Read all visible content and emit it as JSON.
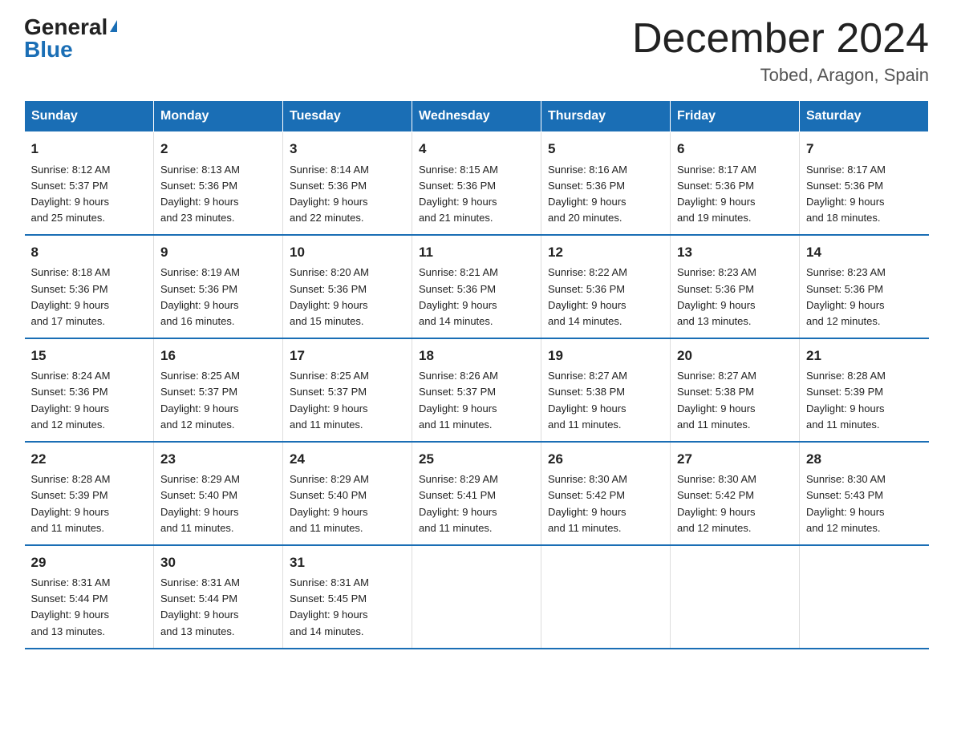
{
  "logo": {
    "general": "General",
    "blue": "Blue",
    "triangle": "▶"
  },
  "title": "December 2024",
  "subtitle": "Tobed, Aragon, Spain",
  "days_header": [
    "Sunday",
    "Monday",
    "Tuesday",
    "Wednesday",
    "Thursday",
    "Friday",
    "Saturday"
  ],
  "weeks": [
    [
      {
        "day": "1",
        "sunrise": "8:12 AM",
        "sunset": "5:37 PM",
        "daylight": "9 hours and 25 minutes."
      },
      {
        "day": "2",
        "sunrise": "8:13 AM",
        "sunset": "5:36 PM",
        "daylight": "9 hours and 23 minutes."
      },
      {
        "day": "3",
        "sunrise": "8:14 AM",
        "sunset": "5:36 PM",
        "daylight": "9 hours and 22 minutes."
      },
      {
        "day": "4",
        "sunrise": "8:15 AM",
        "sunset": "5:36 PM",
        "daylight": "9 hours and 21 minutes."
      },
      {
        "day": "5",
        "sunrise": "8:16 AM",
        "sunset": "5:36 PM",
        "daylight": "9 hours and 20 minutes."
      },
      {
        "day": "6",
        "sunrise": "8:17 AM",
        "sunset": "5:36 PM",
        "daylight": "9 hours and 19 minutes."
      },
      {
        "day": "7",
        "sunrise": "8:17 AM",
        "sunset": "5:36 PM",
        "daylight": "9 hours and 18 minutes."
      }
    ],
    [
      {
        "day": "8",
        "sunrise": "8:18 AM",
        "sunset": "5:36 PM",
        "daylight": "9 hours and 17 minutes."
      },
      {
        "day": "9",
        "sunrise": "8:19 AM",
        "sunset": "5:36 PM",
        "daylight": "9 hours and 16 minutes."
      },
      {
        "day": "10",
        "sunrise": "8:20 AM",
        "sunset": "5:36 PM",
        "daylight": "9 hours and 15 minutes."
      },
      {
        "day": "11",
        "sunrise": "8:21 AM",
        "sunset": "5:36 PM",
        "daylight": "9 hours and 14 minutes."
      },
      {
        "day": "12",
        "sunrise": "8:22 AM",
        "sunset": "5:36 PM",
        "daylight": "9 hours and 14 minutes."
      },
      {
        "day": "13",
        "sunrise": "8:23 AM",
        "sunset": "5:36 PM",
        "daylight": "9 hours and 13 minutes."
      },
      {
        "day": "14",
        "sunrise": "8:23 AM",
        "sunset": "5:36 PM",
        "daylight": "9 hours and 12 minutes."
      }
    ],
    [
      {
        "day": "15",
        "sunrise": "8:24 AM",
        "sunset": "5:36 PM",
        "daylight": "9 hours and 12 minutes."
      },
      {
        "day": "16",
        "sunrise": "8:25 AM",
        "sunset": "5:37 PM",
        "daylight": "9 hours and 12 minutes."
      },
      {
        "day": "17",
        "sunrise": "8:25 AM",
        "sunset": "5:37 PM",
        "daylight": "9 hours and 11 minutes."
      },
      {
        "day": "18",
        "sunrise": "8:26 AM",
        "sunset": "5:37 PM",
        "daylight": "9 hours and 11 minutes."
      },
      {
        "day": "19",
        "sunrise": "8:27 AM",
        "sunset": "5:38 PM",
        "daylight": "9 hours and 11 minutes."
      },
      {
        "day": "20",
        "sunrise": "8:27 AM",
        "sunset": "5:38 PM",
        "daylight": "9 hours and 11 minutes."
      },
      {
        "day": "21",
        "sunrise": "8:28 AM",
        "sunset": "5:39 PM",
        "daylight": "9 hours and 11 minutes."
      }
    ],
    [
      {
        "day": "22",
        "sunrise": "8:28 AM",
        "sunset": "5:39 PM",
        "daylight": "9 hours and 11 minutes."
      },
      {
        "day": "23",
        "sunrise": "8:29 AM",
        "sunset": "5:40 PM",
        "daylight": "9 hours and 11 minutes."
      },
      {
        "day": "24",
        "sunrise": "8:29 AM",
        "sunset": "5:40 PM",
        "daylight": "9 hours and 11 minutes."
      },
      {
        "day": "25",
        "sunrise": "8:29 AM",
        "sunset": "5:41 PM",
        "daylight": "9 hours and 11 minutes."
      },
      {
        "day": "26",
        "sunrise": "8:30 AM",
        "sunset": "5:42 PM",
        "daylight": "9 hours and 11 minutes."
      },
      {
        "day": "27",
        "sunrise": "8:30 AM",
        "sunset": "5:42 PM",
        "daylight": "9 hours and 12 minutes."
      },
      {
        "day": "28",
        "sunrise": "8:30 AM",
        "sunset": "5:43 PM",
        "daylight": "9 hours and 12 minutes."
      }
    ],
    [
      {
        "day": "29",
        "sunrise": "8:31 AM",
        "sunset": "5:44 PM",
        "daylight": "9 hours and 13 minutes."
      },
      {
        "day": "30",
        "sunrise": "8:31 AM",
        "sunset": "5:44 PM",
        "daylight": "9 hours and 13 minutes."
      },
      {
        "day": "31",
        "sunrise": "8:31 AM",
        "sunset": "5:45 PM",
        "daylight": "9 hours and 14 minutes."
      },
      null,
      null,
      null,
      null
    ]
  ],
  "labels": {
    "sunrise": "Sunrise:",
    "sunset": "Sunset:",
    "daylight": "Daylight:"
  }
}
